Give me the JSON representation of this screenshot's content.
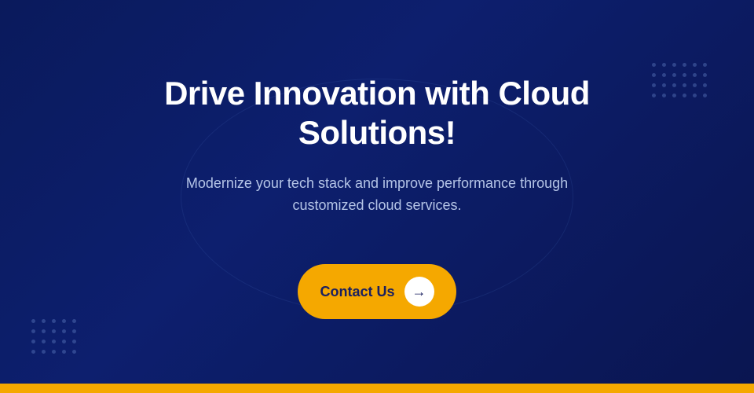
{
  "page": {
    "background_color": "#0a1a5c",
    "gold_bar_color": "#f5a800"
  },
  "hero": {
    "title": "Drive Innovation with Cloud Solutions!",
    "subtitle": "Modernize your tech stack and improve performance through\ncustomized cloud services.",
    "cta_label": "Contact Us",
    "cta_arrow": "→"
  },
  "dot_grids": {
    "top_right_count": 24,
    "bottom_left_count": 20,
    "dot_color": "rgba(100, 130, 200, 0.4)"
  }
}
